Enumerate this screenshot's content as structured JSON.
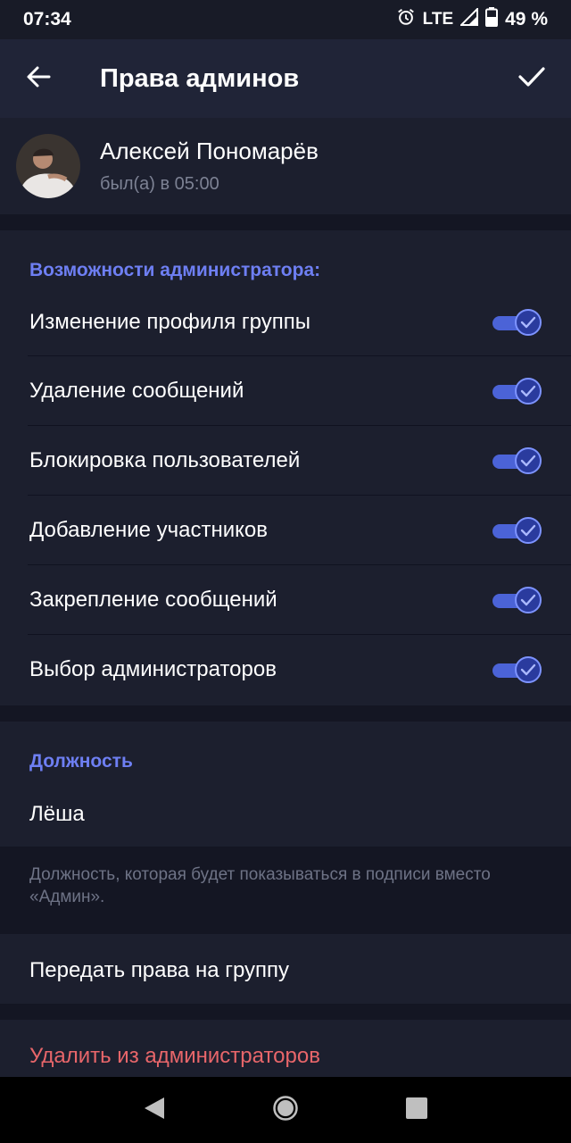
{
  "status": {
    "time": "07:34",
    "network": "LTE",
    "battery": "49 %"
  },
  "appbar": {
    "title": "Права админов"
  },
  "user": {
    "name": "Алексей Пономарёв",
    "last_seen": "был(а) в 05:00"
  },
  "permissions": {
    "header": "Возможности администратора:",
    "items": [
      {
        "label": "Изменение профиля группы",
        "enabled": true
      },
      {
        "label": "Удаление сообщений",
        "enabled": true
      },
      {
        "label": "Блокировка пользователей",
        "enabled": true
      },
      {
        "label": "Добавление участников",
        "enabled": true
      },
      {
        "label": "Закрепление сообщений",
        "enabled": true
      },
      {
        "label": "Выбор администраторов",
        "enabled": true
      }
    ]
  },
  "position": {
    "header": "Должность",
    "value": "Лёша",
    "hint": "Должность, которая будет показываться в подписи вместо «Админ»."
  },
  "transfer": {
    "label": "Передать права на группу"
  },
  "remove": {
    "label": "Удалить из администраторов"
  },
  "colors": {
    "accent": "#6e7ff3",
    "toggle_on": "#4b63d7",
    "danger": "#e8666a",
    "background": "#1c1f2e"
  },
  "icons": [
    "back-arrow-icon",
    "check-icon",
    "alarm-icon",
    "signal-icon",
    "battery-icon",
    "nav-back-icon",
    "nav-home-icon",
    "nav-recents-icon"
  ]
}
